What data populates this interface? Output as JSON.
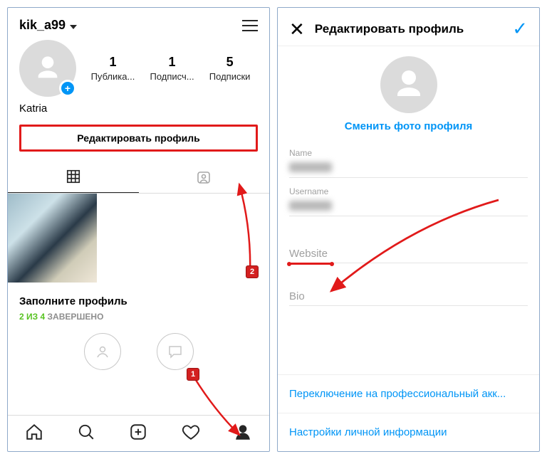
{
  "left": {
    "username": "kik_a99",
    "display_name": "Katria",
    "stats": [
      {
        "num": "1",
        "label": "Публика..."
      },
      {
        "num": "1",
        "label": "Подписч..."
      },
      {
        "num": "5",
        "label": "Подписки"
      }
    ],
    "edit_profile": "Редактировать профиль",
    "complete_title": "Заполните профиль",
    "complete_done": "2 ИЗ 4",
    "complete_rest": " ЗАВЕРШЕНО"
  },
  "right": {
    "title": "Редактировать профиль",
    "change_photo": "Сменить фото профиля",
    "fields": {
      "name_label": "Name",
      "username_label": "Username",
      "website_label": "Website",
      "bio_label": "Bio"
    },
    "switch_pro": "Переключение на профессиональный акк...",
    "personal_info": "Настройки личной информации"
  },
  "annotations": {
    "n1": "1",
    "n2": "2"
  }
}
